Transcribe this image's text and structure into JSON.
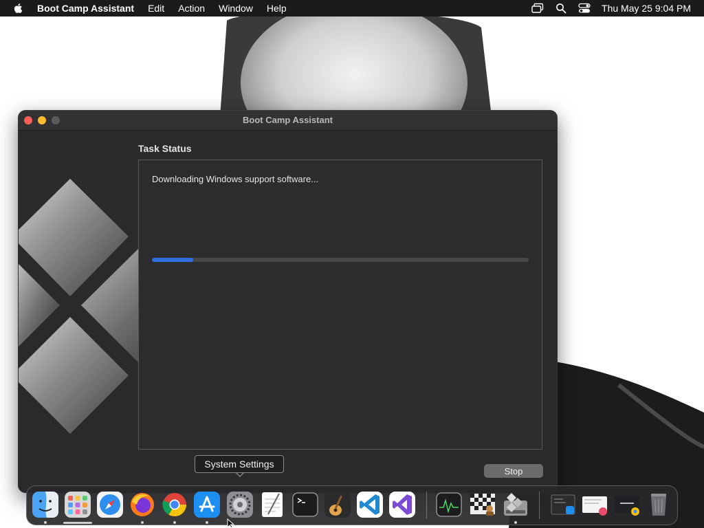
{
  "menubar": {
    "app_name": "Boot Camp Assistant",
    "menus": [
      "Edit",
      "Action",
      "Window",
      "Help"
    ],
    "clock": "Thu May 25  9:04 PM"
  },
  "window": {
    "title": "Boot Camp Assistant",
    "task_heading": "Task Status",
    "status_text": "Downloading Windows support software...",
    "progress": 0.11,
    "stop_label": "Stop"
  },
  "tooltip": {
    "text": "System Settings"
  },
  "dock": {
    "items": [
      {
        "name": "finder",
        "running": true
      },
      {
        "name": "launchpad",
        "running": false
      },
      {
        "name": "safari",
        "running": false
      },
      {
        "name": "firefox",
        "running": true
      },
      {
        "name": "chrome",
        "running": true
      },
      {
        "name": "app-store",
        "running": true
      },
      {
        "name": "system-settings",
        "running": false
      },
      {
        "name": "textedit",
        "running": false
      },
      {
        "name": "terminal",
        "running": false
      },
      {
        "name": "garageband",
        "running": false
      },
      {
        "name": "vscode",
        "running": false
      },
      {
        "name": "visual-studio",
        "running": false
      },
      {
        "name": "activity-monitor",
        "running": false
      },
      {
        "name": "chess",
        "running": false
      },
      {
        "name": "boot-camp-assistant",
        "running": true
      },
      {
        "name": "downloads-stack",
        "running": false
      },
      {
        "name": "recent-windows-stack",
        "running": false
      },
      {
        "name": "recent-chrome-stack",
        "running": false
      },
      {
        "name": "trash",
        "running": false
      }
    ]
  },
  "colors": {
    "accent": "#2f6de0",
    "close": "#ff5f57",
    "minimize": "#febc2e"
  }
}
